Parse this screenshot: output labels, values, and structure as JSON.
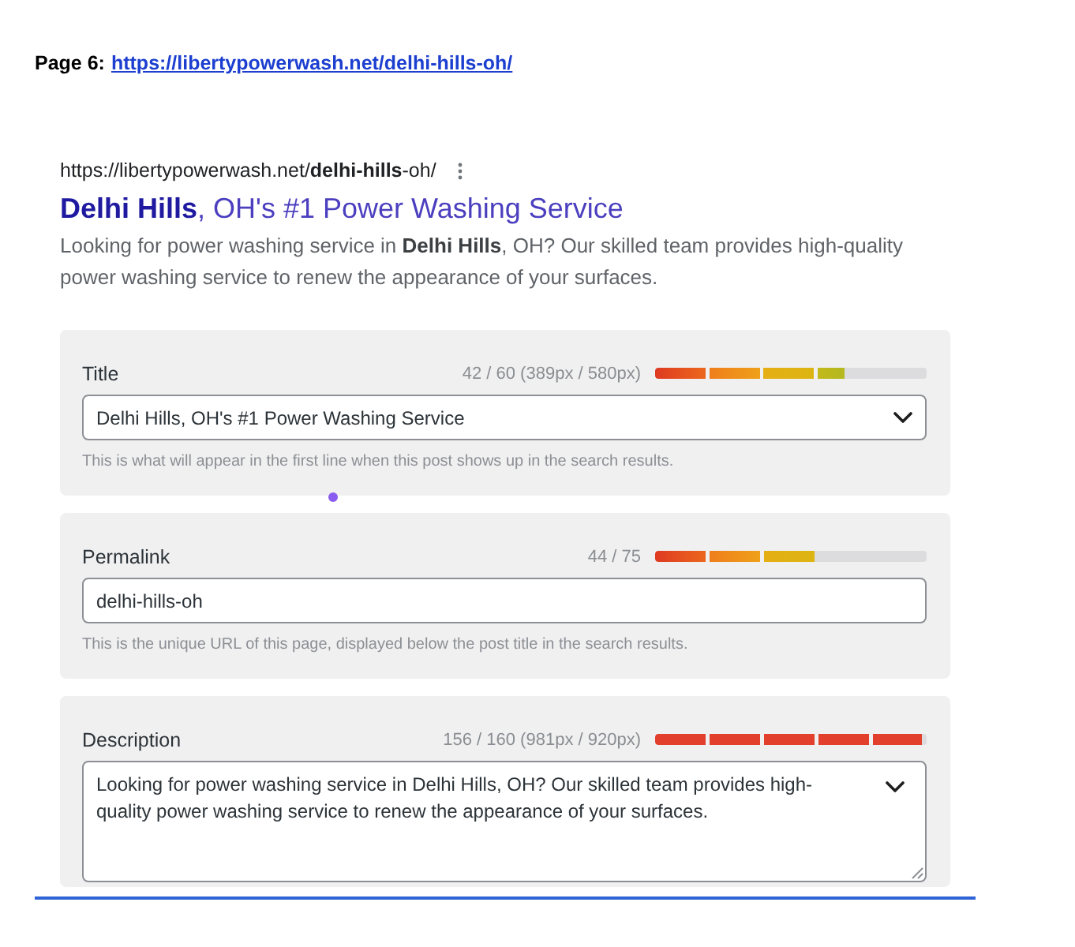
{
  "header": {
    "label": "Page 6:",
    "link": "https://libertypowerwash.net/delhi-hills-oh/"
  },
  "preview": {
    "url": "https://libertypowerwash.net/**delhi-hills**-oh/",
    "title": "**Delhi Hills**, OH's #1 Power Washing Service",
    "description": "Looking for power washing service in **Delhi Hills**, OH? Our skilled team provides high-quality power washing service to renew the appearance of your surfaces."
  },
  "fields": [
    {
      "kind": "select",
      "label": "Title",
      "counter": "42 / 60 (389px / 580px)",
      "meter": {
        "level": 0.7,
        "over_limit": false
      },
      "value": "Delhi Hills, OH's #1 Power Washing Service",
      "hint": "This is what will appear in the first line when this post shows up in the search results."
    },
    {
      "kind": "text",
      "label": "Permalink",
      "counter": "44 / 75",
      "meter": {
        "level": 0.587,
        "over_limit": false
      },
      "value": "delhi-hills-oh",
      "hint": "This is the unique URL of this page, displayed below the post title in the search results."
    },
    {
      "kind": "textarea",
      "label": "Description",
      "counter": "156 / 160 (981px / 920px)",
      "meter": {
        "level": 0.98,
        "over_limit": true
      },
      "value": "Looking for power washing service in Delhi Hills, OH? Our skilled team provides high-quality power washing service to renew the appearance of your surfaces."
    }
  ]
}
